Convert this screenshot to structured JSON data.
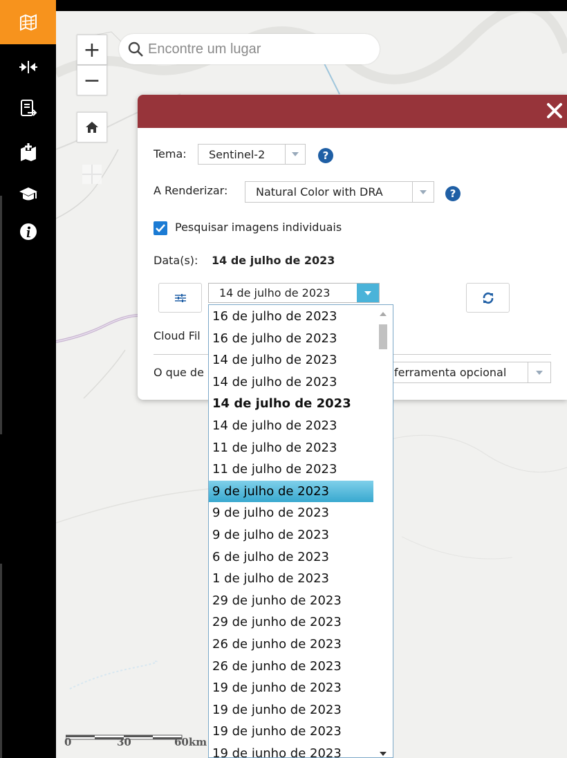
{
  "toolbar": {
    "items": [
      {
        "icon": "map-layers-icon",
        "active": true
      },
      {
        "icon": "swipe-compare-icon"
      },
      {
        "icon": "export-icon"
      },
      {
        "icon": "add-data-icon"
      },
      {
        "icon": "education-cap-icon"
      },
      {
        "icon": "info-icon"
      }
    ],
    "accent_color": "#f7931d"
  },
  "map": {
    "search_placeholder": "Encontre um lugar",
    "zoom_in": "+",
    "zoom_out": "−",
    "scale": {
      "labels": [
        "0",
        "30",
        "60km"
      ]
    }
  },
  "panel": {
    "header_color": "#97343a",
    "tema_label": "Tema:",
    "tema_value": "Sentinel-2",
    "render_label": "A Renderizar:",
    "render_value": "Natural Color with DRA",
    "help_glyph": "?",
    "search_individual_label": "Pesquisar imagens individuais",
    "search_individual_checked": true,
    "dates_label": "Data(s):",
    "dates_value": "14 de julho de 2023",
    "date_select_value": "14 de julho de 2023",
    "cloud_filter_partial": "Cloud Fil",
    "what_partial": "O que de",
    "optional_tool_value": "ferramenta opcional"
  },
  "dropdown": {
    "highlight_color": "#38a8cf",
    "items": [
      {
        "label": "16 de julho de 2023"
      },
      {
        "label": "16 de julho de 2023"
      },
      {
        "label": "14 de julho de 2023"
      },
      {
        "label": "14 de julho de 2023"
      },
      {
        "label": "14 de julho de 2023",
        "selected": true
      },
      {
        "label": "14 de julho de 2023"
      },
      {
        "label": "11 de julho de 2023"
      },
      {
        "label": "11 de julho de 2023"
      },
      {
        "label": "9 de julho de 2023",
        "highlighted": true
      },
      {
        "label": "9 de julho de 2023"
      },
      {
        "label": "9 de julho de 2023"
      },
      {
        "label": "6 de julho de 2023"
      },
      {
        "label": "1 de julho de 2023"
      },
      {
        "label": "29 de junho de 2023"
      },
      {
        "label": "29 de junho de 2023"
      },
      {
        "label": "26 de junho de 2023"
      },
      {
        "label": "26 de junho de 2023"
      },
      {
        "label": "19 de junho de 2023"
      },
      {
        "label": "19 de junho de 2023"
      },
      {
        "label": "19 de junho de 2023"
      },
      {
        "label": "19 de junho de 2023"
      }
    ]
  }
}
